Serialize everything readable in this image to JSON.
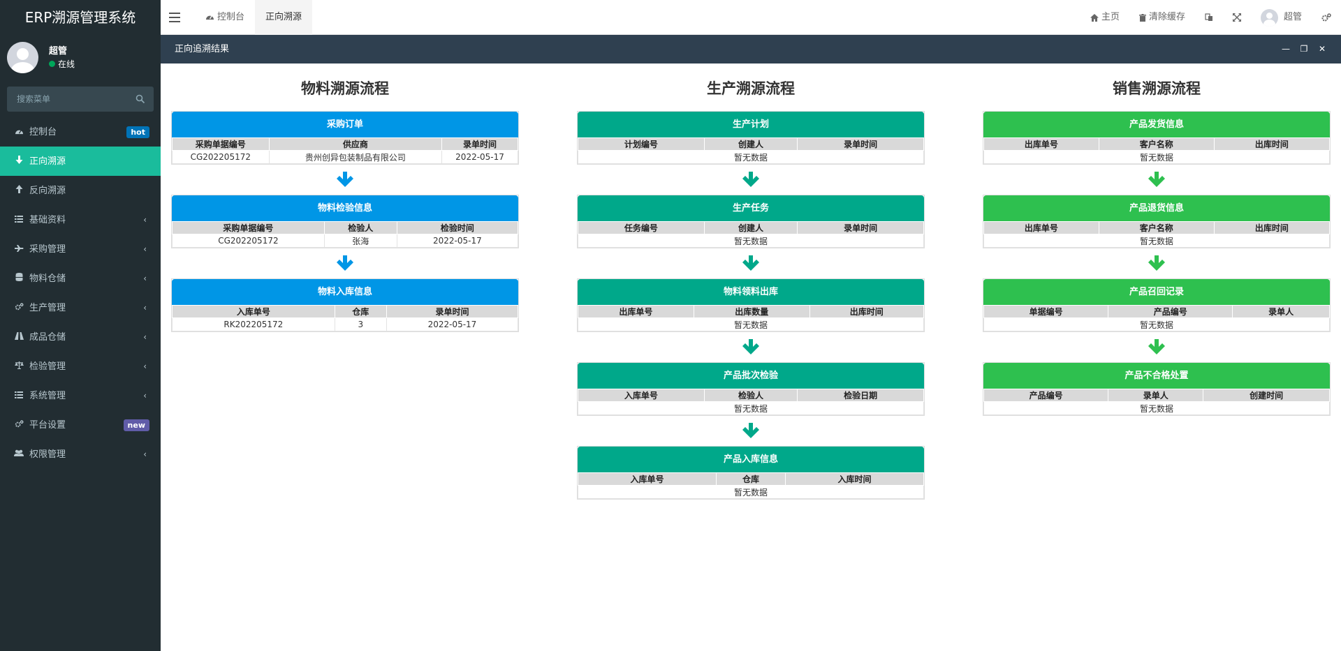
{
  "app": {
    "title": "ERP溯源管理系统"
  },
  "user": {
    "name": "超管",
    "status": "在线"
  },
  "search": {
    "placeholder": "搜索菜单"
  },
  "menu": [
    {
      "label": "控制台",
      "icon": "dashboard-icon",
      "badge": "hot"
    },
    {
      "label": "正向溯源",
      "icon": "arrow-down-icon",
      "active": true
    },
    {
      "label": "反向溯源",
      "icon": "arrow-up-icon"
    },
    {
      "label": "基础资料",
      "icon": "list-icon",
      "chevron": true
    },
    {
      "label": "采购管理",
      "icon": "plane-icon",
      "chevron": true
    },
    {
      "label": "物料仓储",
      "icon": "database-icon",
      "chevron": true
    },
    {
      "label": "生产管理",
      "icon": "cogs-icon",
      "chevron": true
    },
    {
      "label": "成品仓储",
      "icon": "road-icon",
      "chevron": true
    },
    {
      "label": "检验管理",
      "icon": "balance-icon",
      "chevron": true
    },
    {
      "label": "系统管理",
      "icon": "list-icon",
      "chevron": true
    },
    {
      "label": "平台设置",
      "icon": "cogs-icon",
      "badge": "new"
    },
    {
      "label": "权限管理",
      "icon": "users-icon",
      "chevron": true
    }
  ],
  "topbar": {
    "tabs": [
      "控制台",
      "正向溯源"
    ],
    "home": "主页",
    "clear_cache": "清除缓存",
    "username": "超管"
  },
  "panel": {
    "title": "正向追溯结果"
  },
  "columns": [
    {
      "title": "物料溯源流程",
      "theme": "blue",
      "cards": [
        {
          "title": "采购订单",
          "headers": [
            "采购单据编号",
            "供应商",
            "录单时间"
          ],
          "widths": [
            28,
            50,
            22
          ],
          "rows": [
            [
              "CG202205172",
              "贵州创异包装制品有限公司",
              "2022-05-17"
            ]
          ]
        },
        {
          "title": "物料检验信息",
          "headers": [
            "采购单据编号",
            "检验人",
            "检验时间"
          ],
          "widths": [
            44,
            21,
            35
          ],
          "rows": [
            [
              "CG202205172",
              "张海",
              "2022-05-17"
            ]
          ]
        },
        {
          "title": "物料入库信息",
          "headers": [
            "入库单号",
            "仓库",
            "录单时间"
          ],
          "widths": [
            47,
            15,
            38
          ],
          "rows": [
            [
              "RK202205172",
              "3",
              "2022-05-17"
            ]
          ]
        }
      ]
    },
    {
      "title": "生产溯源流程",
      "theme": "teal",
      "cards": [
        {
          "title": "生产计划",
          "headers": [
            "计划编号",
            "创建人",
            "录单时间"
          ],
          "widths": [
            36.5,
            27,
            36.5
          ],
          "empty": "暂无数据"
        },
        {
          "title": "生产任务",
          "headers": [
            "任务编号",
            "创建人",
            "录单时间"
          ],
          "widths": [
            36.5,
            27,
            36.5
          ],
          "empty": "暂无数据"
        },
        {
          "title": "物料领料出库",
          "headers": [
            "出库单号",
            "出库数量",
            "出库时间"
          ],
          "widths": [
            33.5,
            33.5,
            33
          ],
          "empty": "暂无数据"
        },
        {
          "title": "产品批次检验",
          "headers": [
            "入库单号",
            "检验人",
            "检验日期"
          ],
          "widths": [
            36.5,
            27,
            36.5
          ],
          "empty": "暂无数据"
        },
        {
          "title": "产品入库信息",
          "headers": [
            "入库单号",
            "仓库",
            "入库时间"
          ],
          "widths": [
            40,
            20,
            40
          ],
          "empty": "暂无数据"
        }
      ]
    },
    {
      "title": "销售溯源流程",
      "theme": "green",
      "cards": [
        {
          "title": "产品发货信息",
          "headers": [
            "出库单号",
            "客户名称",
            "出库时间"
          ],
          "widths": [
            33.3,
            33.3,
            33.4
          ],
          "empty": "暂无数据"
        },
        {
          "title": "产品退货信息",
          "headers": [
            "出库单号",
            "客户名称",
            "出库时间"
          ],
          "widths": [
            33.3,
            33.3,
            33.4
          ],
          "empty": "暂无数据"
        },
        {
          "title": "产品召回记录",
          "headers": [
            "单据编号",
            "产品编号",
            "录单人"
          ],
          "widths": [
            36,
            36,
            28
          ],
          "empty": "暂无数据"
        },
        {
          "title": "产品不合格处置",
          "headers": [
            "产品编号",
            "录单人",
            "创建时间"
          ],
          "widths": [
            36,
            27.5,
            36.5
          ],
          "empty": "暂无数据"
        }
      ]
    }
  ],
  "colors": {
    "blue": "#0096e6",
    "teal": "#00a88a",
    "green": "#2ec04f",
    "sidebar": "#222d32",
    "active": "#1abc9c"
  }
}
